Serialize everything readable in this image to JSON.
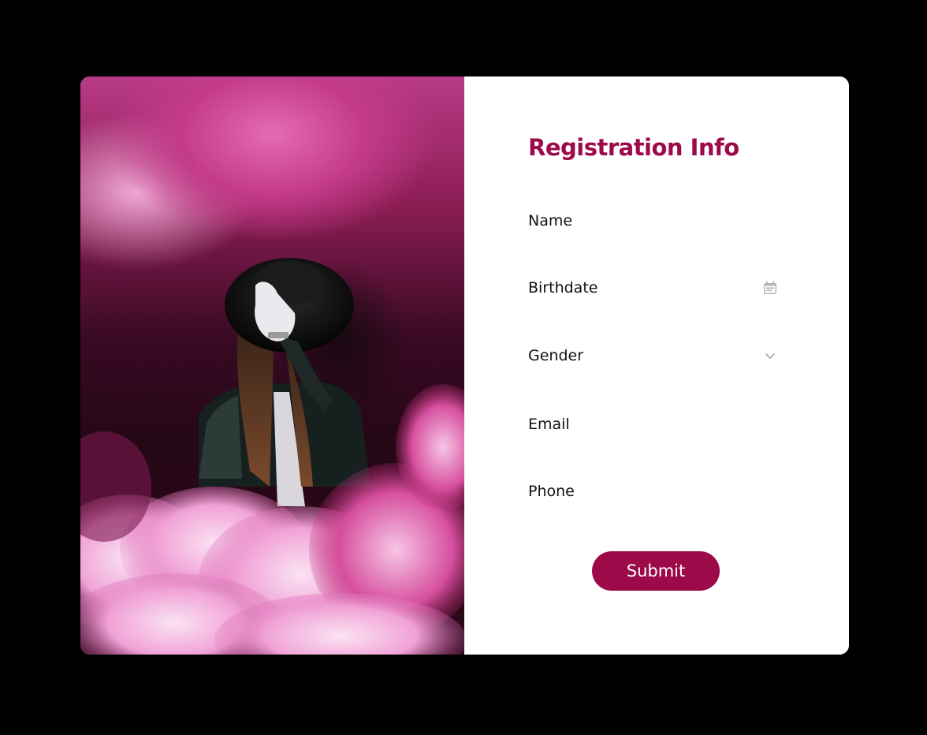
{
  "form": {
    "title": "Registration Info",
    "fields": [
      {
        "label": "Name",
        "icon": null
      },
      {
        "label": "Birthdate",
        "icon": "calendar-icon"
      },
      {
        "label": "Gender",
        "icon": "chevron-down-icon"
      },
      {
        "label": "Email",
        "icon": null
      },
      {
        "label": "Phone",
        "icon": null
      }
    ],
    "submit_label": "Submit"
  },
  "colors": {
    "accent": "#9c0a4a",
    "background": "#000000",
    "card": "#ffffff",
    "icon_gray": "#b5b5b5"
  }
}
